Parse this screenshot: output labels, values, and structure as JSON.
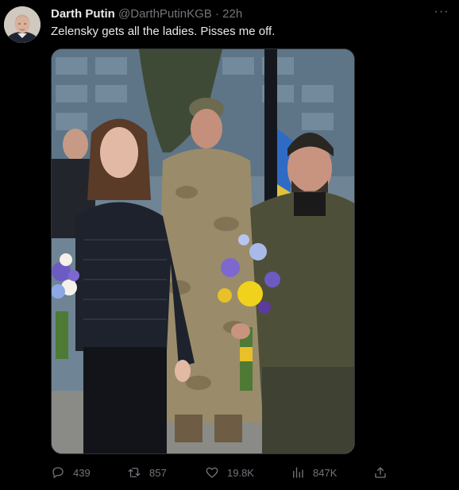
{
  "tweet": {
    "author_name": "Darth Putin",
    "author_handle": "@DarthPutinKGB",
    "separator": "·",
    "time": "22h",
    "text": "Zelensky gets all the ladies. Pisses me off.",
    "more_label": "···"
  },
  "actions": {
    "replies": "439",
    "retweets": "857",
    "likes": "19.8K",
    "views": "847K"
  },
  "icons": {
    "more": "more-icon",
    "reply": "reply-icon",
    "retweet": "retweet-icon",
    "like": "heart-icon",
    "views": "analytics-icon",
    "share": "share-icon"
  },
  "colors": {
    "background": "#000000",
    "text": "#e7e9ea",
    "muted": "#71767b"
  }
}
